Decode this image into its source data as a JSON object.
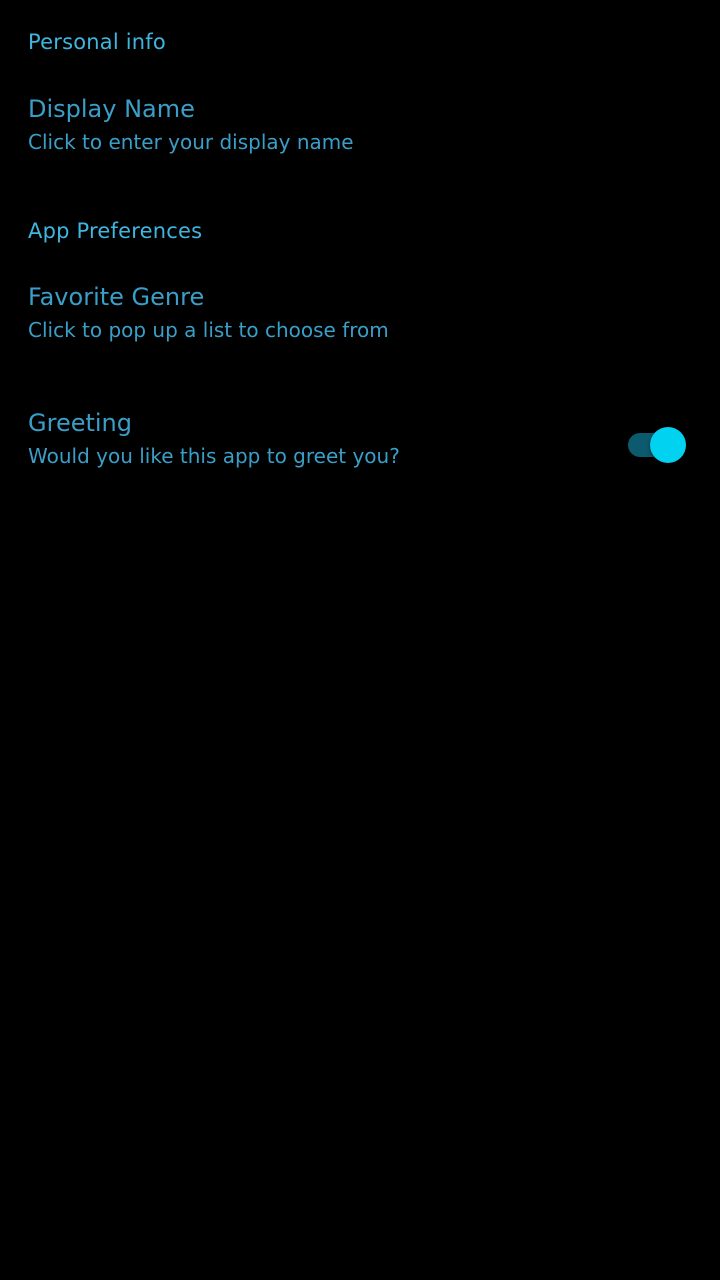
{
  "colors": {
    "background": "#000000",
    "category_text": "#3fb6e0",
    "pref_text": "#3a9fc8",
    "switch_thumb": "#00d2f0",
    "switch_track": "#0b5a6e"
  },
  "sections": [
    {
      "category": "Personal info",
      "prefs": [
        {
          "title": "Display Name",
          "summary": "Click to enter your display name"
        }
      ]
    },
    {
      "category": "App Preferences",
      "prefs": [
        {
          "title": "Favorite Genre",
          "summary": "Click to pop up a list to choose from"
        },
        {
          "title": "Greeting",
          "summary": "Would you like this app to greet you?",
          "toggle": "on"
        }
      ]
    }
  ]
}
